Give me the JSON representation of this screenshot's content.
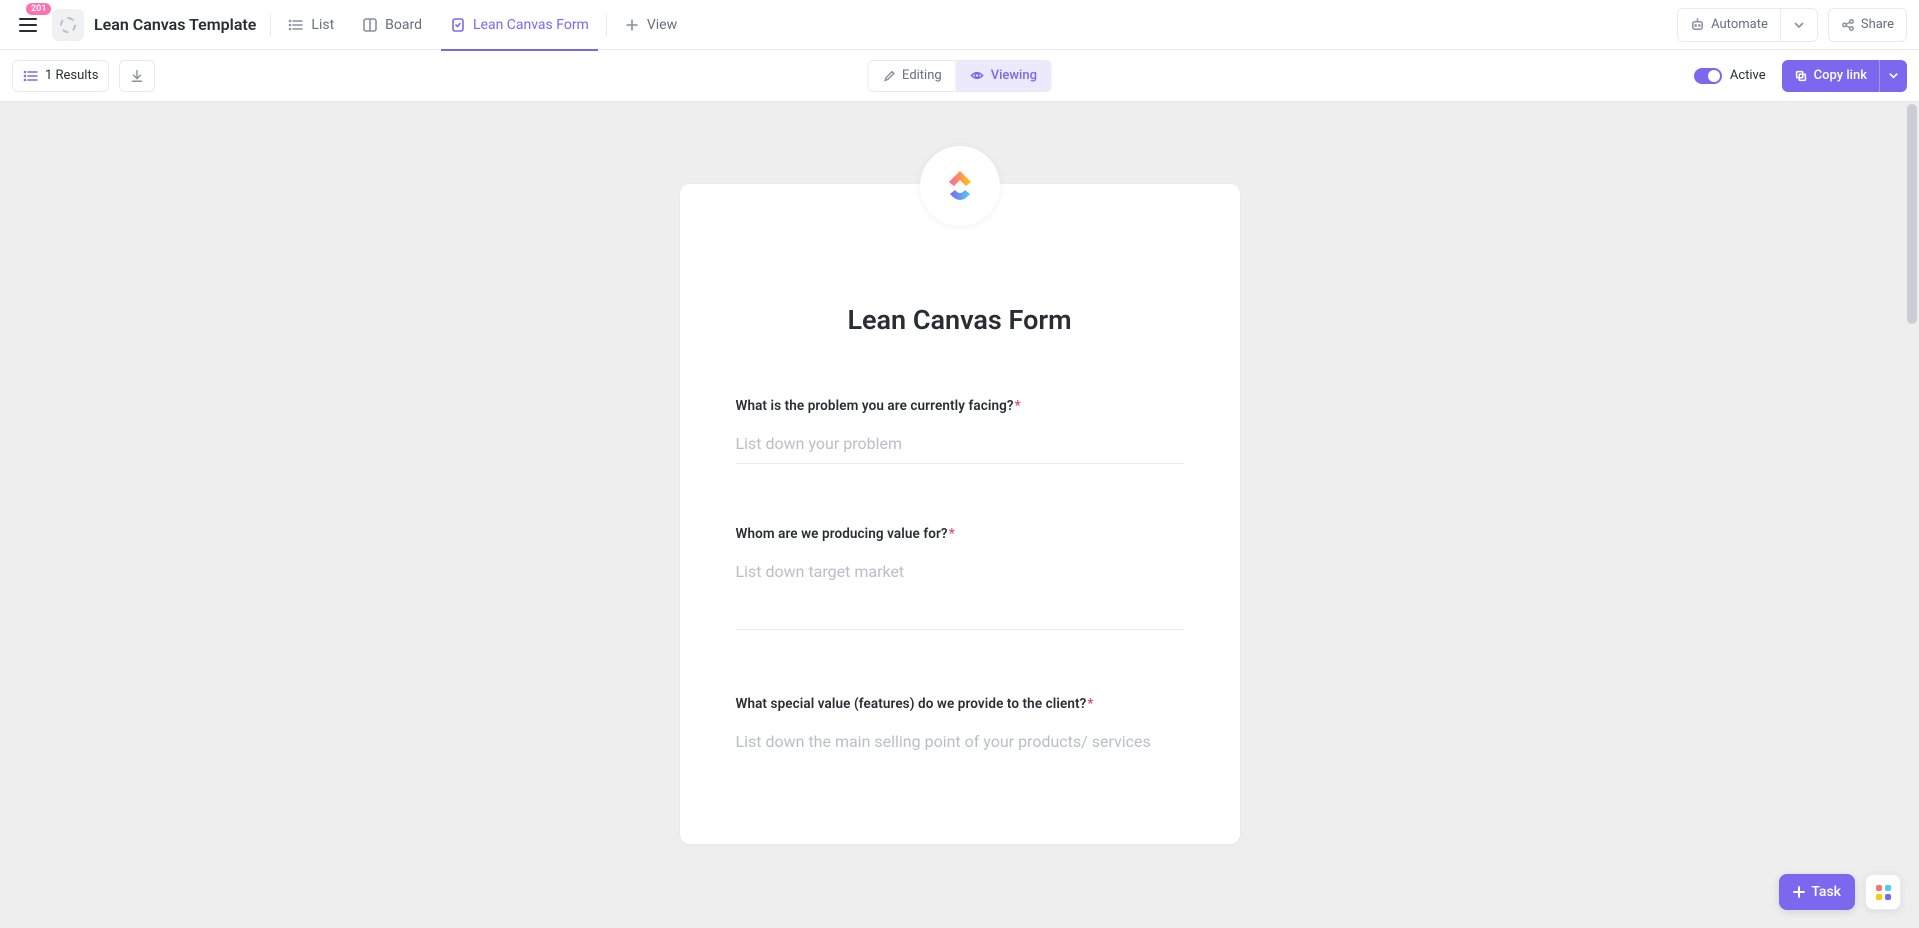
{
  "header": {
    "badge": "201",
    "page_title": "Lean Canvas Template",
    "tabs": {
      "list": "List",
      "board": "Board",
      "form": "Lean Canvas Form",
      "view": "View"
    },
    "automate": "Automate",
    "share": "Share"
  },
  "toolbar": {
    "results": "1 Results",
    "editing": "Editing",
    "viewing": "Viewing",
    "active": "Active",
    "copy_link": "Copy link"
  },
  "form": {
    "title": "Lean Canvas Form",
    "fields": [
      {
        "label": "What is the problem you are currently facing?",
        "required": "*",
        "placeholder": "List down your problem"
      },
      {
        "label": "Whom are we producing value for?",
        "required": "*",
        "placeholder": "List down target market"
      },
      {
        "label": "What special value (features) do we provide to the client?",
        "required": "*",
        "placeholder": "List down the main selling point of your products/ services"
      }
    ]
  },
  "float": {
    "task": "Task"
  }
}
